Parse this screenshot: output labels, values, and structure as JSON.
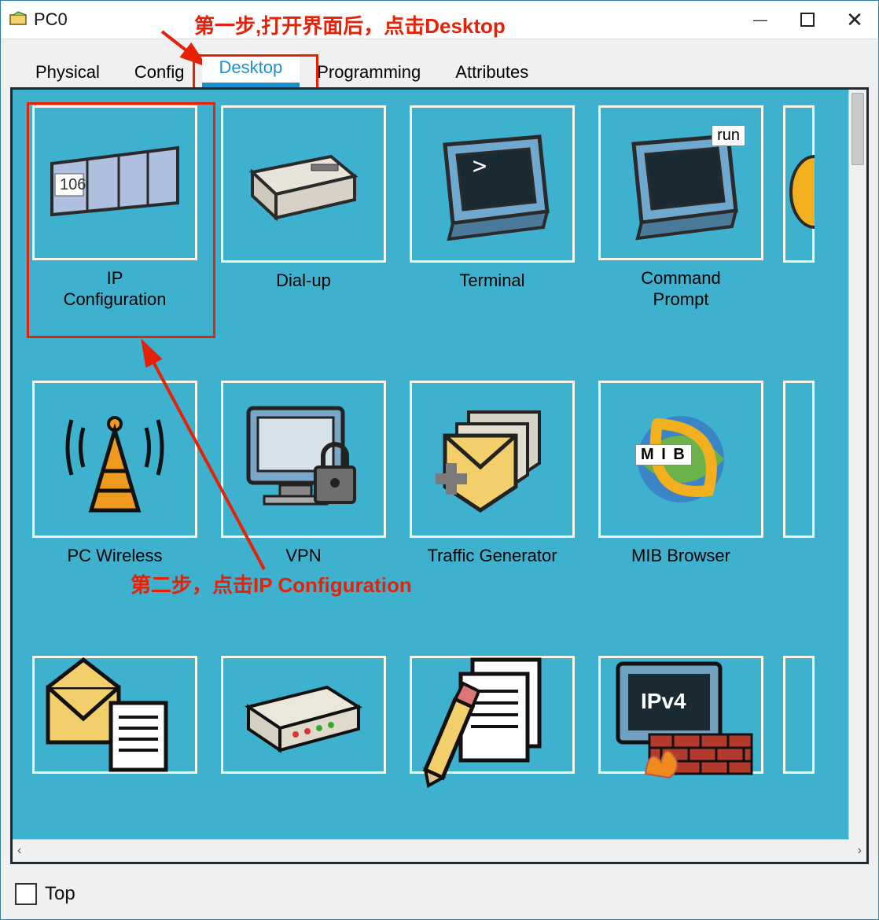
{
  "window": {
    "title": "PC0",
    "minimize": "—",
    "maximize": "☐",
    "close": "✕"
  },
  "tabs": [
    {
      "label": "Physical",
      "active": false
    },
    {
      "label": "Config",
      "active": false
    },
    {
      "label": "Desktop",
      "active": true
    },
    {
      "label": "Programming",
      "active": false
    },
    {
      "label": "Attributes",
      "active": false
    }
  ],
  "apps": [
    {
      "label": "IP\nConfiguration",
      "icon": "ipconfig",
      "badge": "106"
    },
    {
      "label": "Dial-up",
      "icon": "modem"
    },
    {
      "label": "Terminal",
      "icon": "terminal",
      "badge": ">"
    },
    {
      "label": "Command\nPrompt",
      "icon": "cmd",
      "badge": "run"
    },
    {
      "label": "",
      "icon": "partial1"
    },
    {
      "label": "PC Wireless",
      "icon": "wireless"
    },
    {
      "label": "VPN",
      "icon": "vpn"
    },
    {
      "label": "Traffic Generator",
      "icon": "traffic"
    },
    {
      "label": "MIB Browser",
      "icon": "mib",
      "badge": "M I B"
    },
    {
      "label": "",
      "icon": "partial2"
    },
    {
      "label": "",
      "icon": "email"
    },
    {
      "label": "",
      "icon": "switch"
    },
    {
      "label": "",
      "icon": "editor"
    },
    {
      "label": "",
      "icon": "firewall",
      "badge": "IPv4"
    },
    {
      "label": "",
      "icon": "partial3"
    }
  ],
  "annotations": {
    "step1": "第一步,打开界面后，点击Desktop",
    "step2": "第二步，点击IP Configuration"
  },
  "footer": {
    "top_label": "Top"
  },
  "scroll": {
    "left": "‹",
    "right": "›"
  }
}
